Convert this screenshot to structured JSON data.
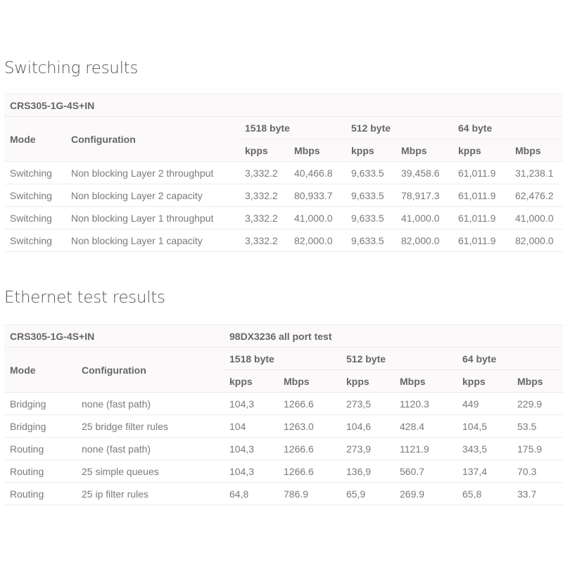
{
  "switching": {
    "title": "Switching results",
    "model": "CRS305-1G-4S+IN",
    "columns": {
      "mode": "Mode",
      "configuration": "Configuration",
      "groups": [
        "1518 byte",
        "512 byte",
        "64 byte"
      ],
      "units": [
        "kpps",
        "Mbps",
        "kpps",
        "Mbps",
        "kpps",
        "Mbps"
      ]
    },
    "rows": [
      {
        "mode": "Switching",
        "configuration": "Non blocking Layer 2 throughput",
        "values": [
          "3,332.2",
          "40,466.8",
          "9,633.5",
          "39,458.6",
          "61,011.9",
          "31,238.1"
        ]
      },
      {
        "mode": "Switching",
        "configuration": "Non blocking Layer 2 capacity",
        "values": [
          "3,332.2",
          "80,933.7",
          "9,633.5",
          "78,917.3",
          "61,011.9",
          "62,476.2"
        ]
      },
      {
        "mode": "Switching",
        "configuration": "Non blocking Layer 1 throughput",
        "values": [
          "3,332.2",
          "41,000.0",
          "9,633.5",
          "41,000.0",
          "61,011.9",
          "41,000.0"
        ]
      },
      {
        "mode": "Switching",
        "configuration": "Non blocking Layer 1 capacity",
        "values": [
          "3,332.2",
          "82,000.0",
          "9,633.5",
          "82,000.0",
          "61,011.9",
          "82,000.0"
        ]
      }
    ]
  },
  "ethernet": {
    "title": "Ethernet test results",
    "model": "CRS305-1G-4S+IN",
    "test_name": "98DX3236 all port test",
    "columns": {
      "mode": "Mode",
      "configuration": "Configuration",
      "groups": [
        "1518 byte",
        "512 byte",
        "64 byte"
      ],
      "units": [
        "kpps",
        "Mbps",
        "kpps",
        "Mbps",
        "kpps",
        "Mbps"
      ]
    },
    "rows": [
      {
        "mode": "Bridging",
        "configuration": "none (fast path)",
        "values": [
          "104,3",
          "1266.6",
          "273,5",
          "1120.3",
          "449",
          "229.9"
        ]
      },
      {
        "mode": "Bridging",
        "configuration": "25 bridge filter rules",
        "values": [
          "104",
          "1263.0",
          "104,6",
          "428.4",
          "104,5",
          "53.5"
        ]
      },
      {
        "mode": "Routing",
        "configuration": "none (fast path)",
        "values": [
          "104,3",
          "1266.6",
          "273,9",
          "1121.9",
          "343,5",
          "175.9"
        ]
      },
      {
        "mode": "Routing",
        "configuration": "25 simple queues",
        "values": [
          "104,3",
          "1266.6",
          "136,9",
          "560.7",
          "137,4",
          "70.3"
        ]
      },
      {
        "mode": "Routing",
        "configuration": "25 ip filter rules",
        "values": [
          "64,8",
          "786.9",
          "65,9",
          "269.9",
          "65,8",
          "33.7"
        ]
      }
    ]
  }
}
